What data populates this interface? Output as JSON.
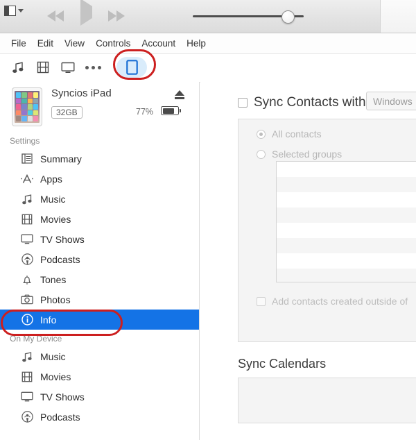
{
  "toolbar": {
    "sidebar_toggle_icon": "sidebar-toggle-icon",
    "chevron_icon": "chevron-down-icon",
    "previous_icon": "rewind-icon",
    "play_icon": "play-icon",
    "next_icon": "fast-forward-icon",
    "volume_icon": "volume-slider"
  },
  "menubar": {
    "items": [
      {
        "label": "File"
      },
      {
        "label": "Edit"
      },
      {
        "label": "View"
      },
      {
        "label": "Controls"
      },
      {
        "label": "Account"
      },
      {
        "label": "Help"
      }
    ]
  },
  "tabstrip": {
    "tabs": [
      {
        "name": "music-tab",
        "icon": "music-note-icon"
      },
      {
        "name": "movies-tab",
        "icon": "film-strip-icon"
      },
      {
        "name": "tv-shows-tab",
        "icon": "monitor-icon"
      },
      {
        "name": "more-tab",
        "icon": "ellipsis-icon"
      }
    ],
    "device_tab": {
      "name": "device-tab",
      "icon": "ipad-icon"
    }
  },
  "device": {
    "name": "Syncios iPad",
    "capacity": "32GB",
    "battery_percent": "77%",
    "battery_level": 77,
    "eject_icon": "eject-icon",
    "thumbnail_icon": "ipad-thumbnail"
  },
  "sidebar": {
    "settings_label": "Settings",
    "settings_items": [
      {
        "label": "Summary",
        "icon": "summary-icon",
        "selected": false
      },
      {
        "label": "Apps",
        "icon": "apps-icon",
        "selected": false
      },
      {
        "label": "Music",
        "icon": "music-note-icon",
        "selected": false
      },
      {
        "label": "Movies",
        "icon": "film-strip-icon",
        "selected": false
      },
      {
        "label": "TV Shows",
        "icon": "monitor-icon",
        "selected": false
      },
      {
        "label": "Podcasts",
        "icon": "podcast-icon",
        "selected": false
      },
      {
        "label": "Tones",
        "icon": "bell-icon",
        "selected": false
      },
      {
        "label": "Photos",
        "icon": "camera-icon",
        "selected": false
      },
      {
        "label": "Info",
        "icon": "info-circle-icon",
        "selected": true
      }
    ],
    "on_my_device_label": "On My Device",
    "device_items": [
      {
        "label": "Music",
        "icon": "music-note-icon"
      },
      {
        "label": "Movies",
        "icon": "film-strip-icon"
      },
      {
        "label": "TV Shows",
        "icon": "monitor-icon"
      },
      {
        "label": "Podcasts",
        "icon": "podcast-icon"
      }
    ]
  },
  "content": {
    "sync_contacts_label": "Sync Contacts with",
    "sync_contacts_checked": false,
    "source_dropdown_value": "Windows",
    "all_contacts_label": "All contacts",
    "selected_groups_label": "Selected groups",
    "add_contacts_label": "Add contacts created outside of",
    "sync_calendars_label": "Sync Calendars"
  },
  "annotations": {
    "device_tab_highlight": "red-ellipse-device-tab",
    "info_highlight": "red-ellipse-info",
    "color": "#cc1f1f"
  },
  "colors": {
    "selection_blue": "#1473e6",
    "device_tab_blue": "#1a6fd4",
    "annotation_red": "#cc1f1f"
  }
}
